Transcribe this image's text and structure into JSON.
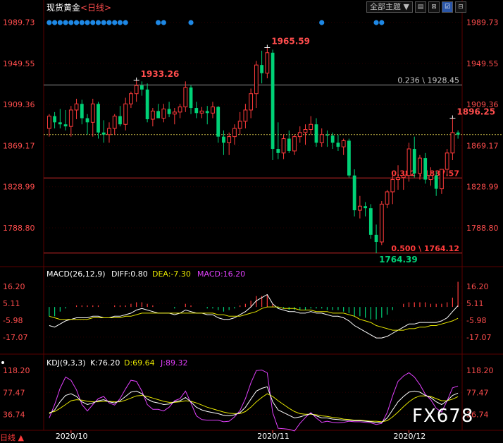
{
  "header": {
    "title": "现货黄金",
    "timeframe": "<日线>"
  },
  "toolbar": {
    "theme_label": "全部主题",
    "theme_arrow": "▼",
    "btn1": "▤",
    "btn2": "⊠",
    "btn3": "☑",
    "btn4": "⊟"
  },
  "colors": {
    "up": "#ff3b3b",
    "down": "#00d277",
    "price_axis": "#ff4d4d",
    "grid": "#2a0000",
    "white_line": "#ffffff",
    "yellow_line": "#e6e600",
    "magenta_line": "#e040fb",
    "dot_blue": "#1e88e5"
  },
  "chart_data": [
    {
      "type": "candlestick",
      "title": "现货黄金 日线",
      "y_ticks": [
        "1989.73",
        "1949.55",
        "1909.36",
        "1869.17",
        "1828.99",
        "1788.80"
      ],
      "ylim": [
        1755,
        1995
      ],
      "x_ticks": [
        "2020/10",
        "2020/11",
        "2020/12"
      ],
      "annotations": [
        {
          "label": "1965.59",
          "type": "high"
        },
        {
          "label": "1933.26",
          "type": "high"
        },
        {
          "label": "1896.25",
          "type": "high"
        },
        {
          "label": "1764.39",
          "type": "low"
        }
      ],
      "fib_levels": [
        {
          "label": "0.236 \\ 1928.45",
          "value": 1928.45
        },
        {
          "label": "0.382 \\ 1837.57",
          "value": 1837.57
        },
        {
          "label": "0.500 \\ 1764.12",
          "value": 1764.12
        }
      ],
      "current_price": 1880,
      "ohlc": [
        [
          1886,
          1900,
          1878,
          1898
        ],
        [
          1898,
          1902,
          1886,
          1892
        ],
        [
          1892,
          1905,
          1886,
          1890
        ],
        [
          1890,
          1904,
          1884,
          1888
        ],
        [
          1888,
          1908,
          1878,
          1904
        ],
        [
          1904,
          1915,
          1895,
          1910
        ],
        [
          1910,
          1914,
          1890,
          1896
        ],
        [
          1896,
          1900,
          1880,
          1892
        ],
        [
          1892,
          1915,
          1878,
          1910
        ],
        [
          1910,
          1912,
          1876,
          1882
        ],
        [
          1882,
          1894,
          1872,
          1880
        ],
        [
          1880,
          1892,
          1872,
          1886
        ],
        [
          1886,
          1900,
          1880,
          1898
        ],
        [
          1898,
          1908,
          1888,
          1890
        ],
        [
          1890,
          1916,
          1884,
          1910
        ],
        [
          1910,
          1922,
          1906,
          1920
        ],
        [
          1920,
          1933,
          1912,
          1928
        ],
        [
          1928,
          1932,
          1918,
          1924
        ],
        [
          1924,
          1930,
          1892,
          1895
        ],
        [
          1895,
          1906,
          1888,
          1903
        ],
        [
          1903,
          1910,
          1896,
          1896
        ],
        [
          1896,
          1910,
          1892,
          1905
        ],
        [
          1905,
          1912,
          1897,
          1900
        ],
        [
          1900,
          1906,
          1890,
          1902
        ],
        [
          1902,
          1910,
          1896,
          1907
        ],
        [
          1907,
          1932,
          1902,
          1926
        ],
        [
          1926,
          1928,
          1900,
          1906
        ],
        [
          1906,
          1912,
          1896,
          1901
        ],
        [
          1901,
          1907,
          1896,
          1903
        ],
        [
          1903,
          1908,
          1890,
          1901
        ],
        [
          1901,
          1912,
          1896,
          1907
        ],
        [
          1907,
          1908,
          1872,
          1878
        ],
        [
          1878,
          1884,
          1860,
          1872
        ],
        [
          1872,
          1882,
          1860,
          1878
        ],
        [
          1878,
          1890,
          1870,
          1886
        ],
        [
          1886,
          1902,
          1880,
          1893
        ],
        [
          1893,
          1910,
          1886,
          1904
        ],
        [
          1904,
          1925,
          1896,
          1920
        ],
        [
          1920,
          1952,
          1906,
          1948
        ],
        [
          1948,
          1962,
          1930,
          1940
        ],
        [
          1940,
          1965,
          1935,
          1960
        ],
        [
          1960,
          1963,
          1855,
          1866
        ],
        [
          1866,
          1892,
          1856,
          1862
        ],
        [
          1862,
          1880,
          1856,
          1876
        ],
        [
          1876,
          1884,
          1862,
          1864
        ],
        [
          1864,
          1880,
          1860,
          1878
        ],
        [
          1878,
          1888,
          1872,
          1882
        ],
        [
          1882,
          1890,
          1870,
          1885
        ],
        [
          1885,
          1898,
          1880,
          1890
        ],
        [
          1890,
          1896,
          1868,
          1872
        ],
        [
          1872,
          1886,
          1868,
          1880
        ],
        [
          1880,
          1884,
          1868,
          1879
        ],
        [
          1879,
          1882,
          1866,
          1872
        ],
        [
          1872,
          1880,
          1864,
          1868
        ],
        [
          1868,
          1876,
          1860,
          1874
        ],
        [
          1874,
          1876,
          1838,
          1840
        ],
        [
          1840,
          1846,
          1800,
          1806
        ],
        [
          1806,
          1820,
          1798,
          1810
        ],
        [
          1810,
          1814,
          1800,
          1808
        ],
        [
          1808,
          1812,
          1778,
          1782
        ],
        [
          1782,
          1792,
          1764,
          1775
        ],
        [
          1775,
          1815,
          1772,
          1812
        ],
        [
          1812,
          1826,
          1808,
          1824
        ],
        [
          1824,
          1840,
          1812,
          1836
        ],
        [
          1836,
          1850,
          1826,
          1838
        ],
        [
          1838,
          1842,
          1826,
          1840
        ],
        [
          1840,
          1872,
          1834,
          1866
        ],
        [
          1866,
          1878,
          1838,
          1842
        ],
        [
          1842,
          1860,
          1836,
          1857
        ],
        [
          1857,
          1862,
          1832,
          1836
        ],
        [
          1836,
          1848,
          1830,
          1840
        ],
        [
          1840,
          1844,
          1820,
          1827
        ],
        [
          1827,
          1846,
          1822,
          1846
        ],
        [
          1846,
          1866,
          1840,
          1862
        ],
        [
          1862,
          1896,
          1855,
          1882
        ],
        [
          1882,
          1884,
          1876,
          1880
        ]
      ]
    },
    {
      "type": "line",
      "title": "MACD(26,12,9)",
      "legend": [
        {
          "label": "DIFF:0.80",
          "color": "#ffffff"
        },
        {
          "label": "DEA:-7.30",
          "color": "#e6e600"
        },
        {
          "label": "MACD:16.20",
          "color": "#e040fb"
        }
      ],
      "y_ticks": [
        "16.20",
        "5.11",
        "-5.98",
        "-17.07"
      ],
      "ylim": [
        -25,
        20
      ],
      "diff": [
        -12,
        -13,
        -11,
        -9,
        -8,
        -7,
        -7,
        -7,
        -6,
        -6,
        -7,
        -7,
        -6,
        -6,
        -5,
        -4,
        -2,
        -1,
        -2,
        -3,
        -4,
        -4,
        -4,
        -5,
        -4,
        -2,
        -3,
        -4,
        -4,
        -5,
        -5,
        -7,
        -8,
        -8,
        -7,
        -5,
        -3,
        0,
        4,
        6,
        8,
        2,
        -1,
        -2,
        -3,
        -3,
        -4,
        -4,
        -3,
        -4,
        -4,
        -5,
        -6,
        -6,
        -7,
        -9,
        -12,
        -14,
        -16,
        -18,
        -20,
        -20,
        -19,
        -17,
        -15,
        -13,
        -11,
        -11,
        -10,
        -10,
        -10,
        -10,
        -9,
        -7,
        -3,
        0.8
      ],
      "dea": [
        -6,
        -7,
        -8,
        -8,
        -8,
        -8,
        -8,
        -8,
        -7,
        -7,
        -7,
        -7,
        -7,
        -7,
        -6,
        -6,
        -5,
        -4,
        -4,
        -4,
        -4,
        -4,
        -4,
        -4,
        -4,
        -4,
        -4,
        -4,
        -4,
        -4,
        -4,
        -5,
        -5,
        -6,
        -6,
        -6,
        -5,
        -4,
        -3,
        -1,
        0,
        0,
        0,
        -1,
        -1,
        -1,
        -2,
        -2,
        -2,
        -3,
        -3,
        -3,
        -4,
        -4,
        -4,
        -5,
        -6,
        -8,
        -9,
        -10,
        -12,
        -13,
        -14,
        -15,
        -15,
        -15,
        -14,
        -14,
        -13,
        -13,
        -12,
        -12,
        -11,
        -10,
        -9,
        -7.3
      ],
      "macd_bars": [
        -6,
        -6,
        -3,
        -1,
        0,
        1,
        1,
        1,
        1,
        1,
        0,
        0,
        1,
        1,
        1,
        2,
        3,
        3,
        2,
        1,
        0,
        0,
        0,
        -1,
        0,
        2,
        1,
        0,
        0,
        -1,
        -1,
        -2,
        -3,
        -2,
        -1,
        1,
        2,
        4,
        7,
        7,
        8,
        2,
        -1,
        -1,
        -2,
        -2,
        -2,
        -2,
        -1,
        -1,
        -1,
        -2,
        -2,
        -2,
        -3,
        -4,
        -6,
        -6,
        -7,
        -8,
        -8,
        -7,
        -5,
        -2,
        0,
        2,
        3,
        3,
        3,
        3,
        2,
        2,
        2,
        3,
        6,
        16.2
      ]
    },
    {
      "type": "line",
      "title": "KDJ(9,3,3)",
      "legend": [
        {
          "label": "K:76.20",
          "color": "#ffffff"
        },
        {
          "label": "D:69.64",
          "color": "#e6e600"
        },
        {
          "label": "J:89.32",
          "color": "#e040fb"
        }
      ],
      "y_ticks": [
        "118.20",
        "77.47",
        "36.74"
      ],
      "ylim": [
        15,
        125
      ],
      "k": [
        38,
        45,
        60,
        72,
        75,
        70,
        60,
        55,
        58,
        62,
        64,
        60,
        58,
        62,
        70,
        78,
        80,
        75,
        65,
        60,
        58,
        55,
        56,
        60,
        62,
        68,
        60,
        50,
        45,
        42,
        40,
        38,
        35,
        34,
        36,
        40,
        50,
        65,
        80,
        85,
        88,
        60,
        45,
        40,
        35,
        30,
        32,
        35,
        38,
        34,
        30,
        30,
        28,
        27,
        26,
        26,
        25,
        25,
        24,
        23,
        22,
        22,
        30,
        45,
        60,
        70,
        78,
        80,
        78,
        72,
        68,
        60,
        55,
        62,
        72,
        76.2
      ],
      "d": [
        40,
        42,
        48,
        55,
        62,
        64,
        63,
        61,
        60,
        60,
        61,
        61,
        60,
        60,
        63,
        67,
        71,
        72,
        70,
        67,
        64,
        61,
        59,
        59,
        60,
        62,
        61,
        58,
        54,
        50,
        47,
        44,
        41,
        39,
        38,
        38,
        42,
        50,
        60,
        68,
        75,
        70,
        62,
        55,
        48,
        42,
        38,
        37,
        37,
        36,
        34,
        33,
        31,
        30,
        28,
        27,
        26,
        26,
        25,
        24,
        24,
        23,
        25,
        32,
        41,
        51,
        60,
        67,
        71,
        71,
        70,
        66,
        62,
        62,
        65,
        69.64
      ],
      "j": [
        30,
        55,
        85,
        106,
        100,
        82,
        55,
        43,
        55,
        66,
        70,
        58,
        54,
        66,
        84,
        100,
        98,
        80,
        55,
        46,
        46,
        43,
        50,
        62,
        66,
        80,
        58,
        34,
        27,
        26,
        26,
        26,
        23,
        24,
        32,
        44,
        66,
        95,
        118,
        119,
        114,
        40,
        11,
        10,
        9,
        6,
        20,
        31,
        40,
        30,
        22,
        24,
        22,
        21,
        22,
        24,
        23,
        23,
        22,
        21,
        18,
        20,
        40,
        71,
        98,
        108,
        114,
        106,
        92,
        74,
        64,
        48,
        41,
        62,
        86,
        89.32
      ]
    }
  ],
  "footer": {
    "period_label": "日线",
    "period_arrow": "▲",
    "watermark": "FX678"
  }
}
